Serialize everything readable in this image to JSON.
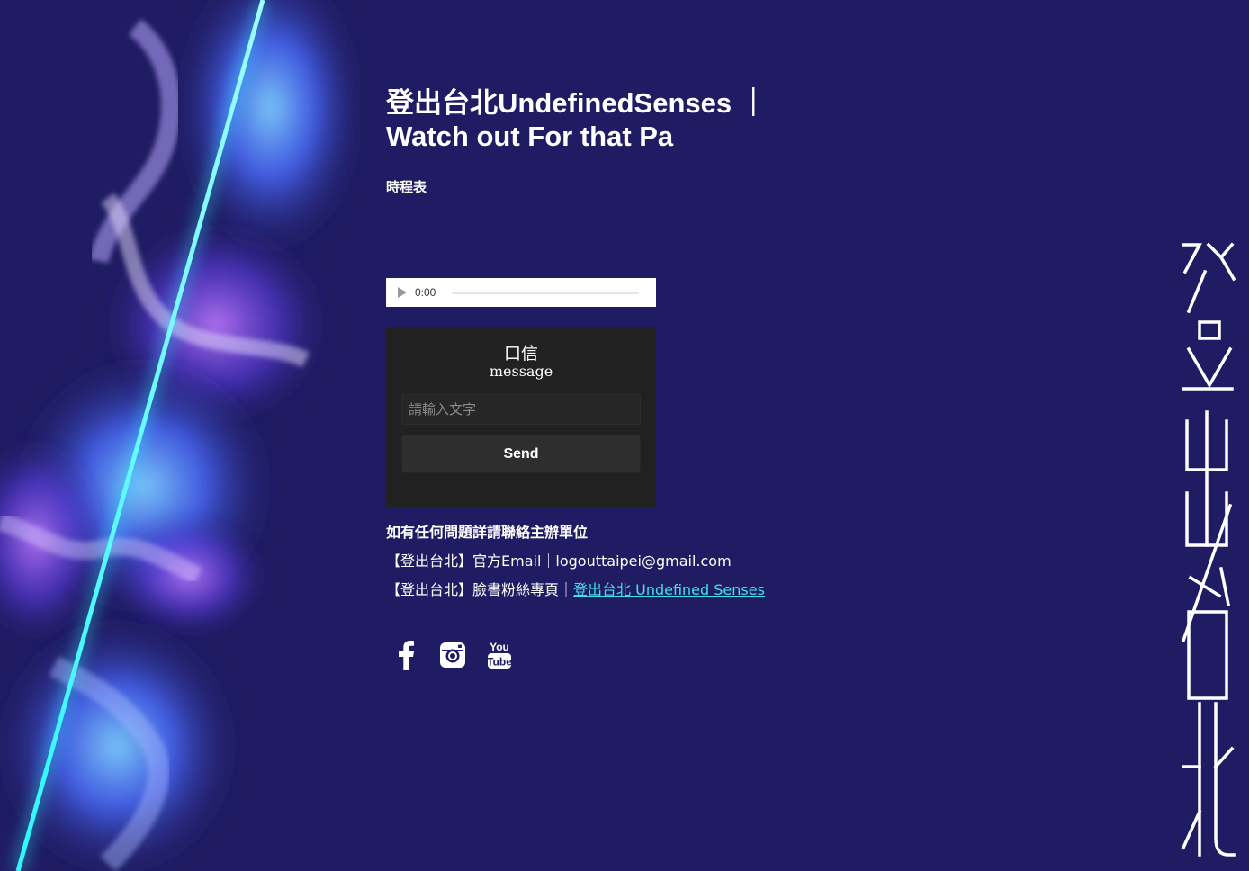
{
  "page": {
    "background": "#201c63",
    "title_line1": "登出台北UndefinedSenses ｜",
    "title_line2": "Watch out For that Pa",
    "schedule_label": "時程表"
  },
  "audio_player": {
    "time": "0:00",
    "progress": 0
  },
  "message_box": {
    "title_zh": "口信",
    "title_en": "message",
    "input_placeholder": "請輸入文字",
    "input_value": "",
    "send_label": "Send"
  },
  "contact": {
    "heading": "如有任何問題詳請聯絡主辦單位",
    "email_prefix": "【登出台北】官方Email｜",
    "email": "logouttaipei@gmail.com",
    "fb_prefix": "【登出台北】臉書粉絲專頁｜",
    "fb_link_text": "登出台北 Undefined Senses",
    "link_color": "#3fe1ee"
  },
  "social_icons": [
    "facebook-icon",
    "instagram-icon",
    "youtube-icon"
  ],
  "youtube_icon_text": {
    "top": "You",
    "bottom": "Tube"
  },
  "accent_colors": {
    "neon_cyan": "#3ff0f5",
    "violet": "#7b4bff",
    "blue": "#3a6bff"
  }
}
